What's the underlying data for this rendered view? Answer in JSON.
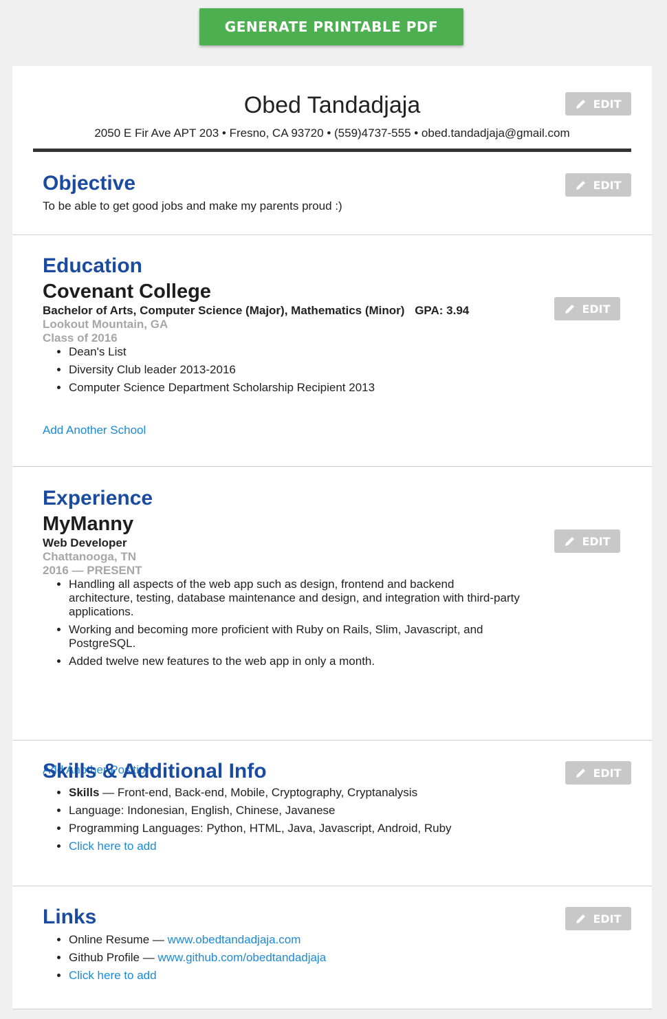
{
  "generate_button": "GENERATE PRINTABLE PDF",
  "edit_label": "EDIT",
  "header": {
    "name": "Obed Tandadjaja",
    "contact": "2050 E Fir Ave APT 203 • Fresno, CA 93720 • (559)4737-555 • obed.tandadjaja@gmail.com"
  },
  "objective": {
    "title": "Objective",
    "text": "To be able to get good jobs and make my parents proud :)"
  },
  "education": {
    "title": "Education",
    "school": "Covenant College",
    "degree": "Bachelor of Arts, Computer Science (Major), Mathematics (Minor)",
    "gpa": "GPA: 3.94",
    "location": "Lookout Mountain, GA",
    "class_year": "Class of 2016",
    "items": [
      "Dean's List",
      "Diversity Club leader 2013-2016",
      "Computer Science Department Scholarship Recipient 2013"
    ],
    "add_link": "Add Another School"
  },
  "experience": {
    "title": "Experience",
    "company": "MyManny",
    "role": "Web Developer",
    "location": "Chattanooga, TN",
    "dates": "2016 — PRESENT",
    "items": [
      "Handling all aspects of the web app such as design, frontend and backend architecture, testing, database maintenance and design, and integration with third-party applications.",
      "Working and becoming more proficient with Ruby on Rails, Slim, Javascript, and PostgreSQL.",
      "Added twelve new features to the web app in only a month."
    ],
    "add_link": "Add Another Position"
  },
  "skills": {
    "title": "Skills & Additional Info",
    "skills_label": "Skills",
    "skills_text": " — Front-end, Back-end, Mobile, Cryptography, Cryptanalysis",
    "language": "Language: Indonesian, English, Chinese, Javanese",
    "programming": "Programming Languages: Python, HTML, Java, Javascript, Android, Ruby",
    "add_link": "Click here to add"
  },
  "links": {
    "title": "Links",
    "items": [
      {
        "label": "Online Resume — ",
        "url": "www.obedtandadjaja.com"
      },
      {
        "label": "Github Profile — ",
        "url": "www.github.com/obedtandadjaja"
      }
    ],
    "add_link": "Click here to add"
  },
  "colors": {
    "accent_green": "#4caf50",
    "heading_blue": "#1b4ba0",
    "link_blue": "#1c8ad6",
    "edit_gray": "#c8c8c8"
  }
}
